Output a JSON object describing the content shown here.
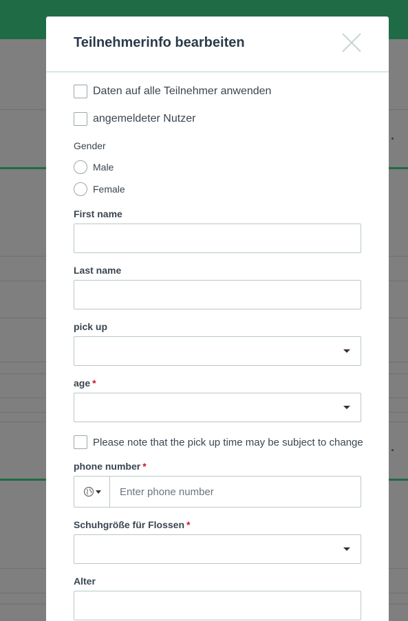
{
  "modal": {
    "title": "Teilnehmerinfo bearbeiten"
  },
  "checkboxes": {
    "apply_all": "Daten auf alle Teilnehmer anwenden",
    "logged_user": "angemeldeter Nutzer",
    "pickup_note": "Please note that the pick up time may be subject to change"
  },
  "gender": {
    "label": "Gender",
    "options": [
      "Male",
      "Female"
    ]
  },
  "fields": {
    "first_name": {
      "label": "First name",
      "value": ""
    },
    "last_name": {
      "label": "Last name",
      "value": ""
    },
    "pick_up": {
      "label": "pick up",
      "selected": ""
    },
    "age": {
      "label": "age",
      "required_mark": "*",
      "selected": ""
    },
    "phone": {
      "label": "phone number",
      "required_mark": "*",
      "placeholder": "Enter phone number",
      "value": ""
    },
    "shoe_size": {
      "label": "Schuhgröße für Flossen",
      "required_mark": "*",
      "selected": ""
    },
    "alter": {
      "label": "Alter",
      "value": ""
    }
  },
  "colors": {
    "brand_green": "#1f6b45",
    "required_red": "#d0142b",
    "border": "#b9c7c7"
  }
}
